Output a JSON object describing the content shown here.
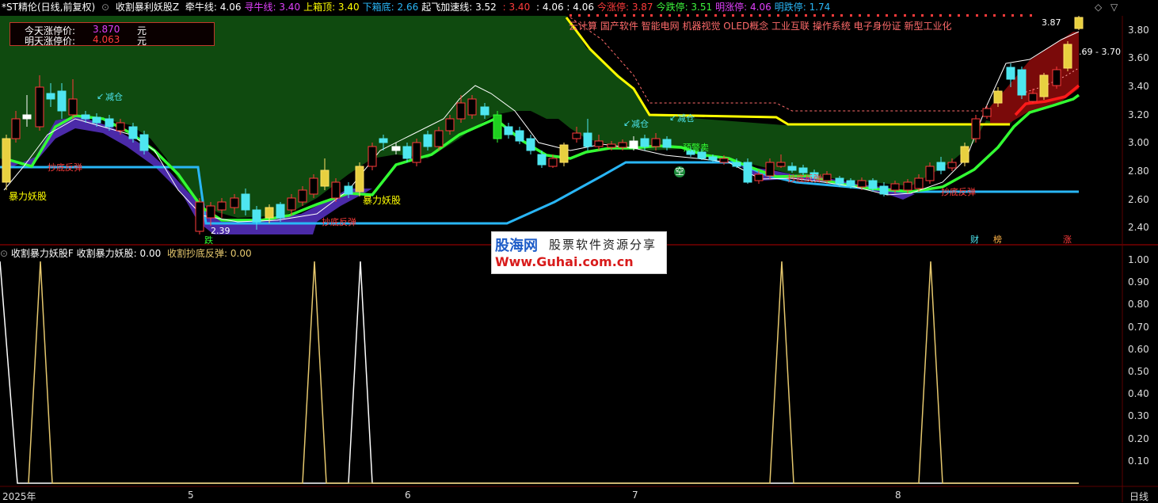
{
  "header": {
    "stock_name": "*ST精伦(日线,前复权)",
    "indicator_name": "收割暴利妖股Z",
    "items": [
      {
        "label": "牵牛线:",
        "value": "4.06",
        "color": "#ffffff"
      },
      {
        "label": "寻牛线:",
        "value": "3.40",
        "color": "#e040fb"
      },
      {
        "label": "上箱顶:",
        "value": "3.40",
        "color": "#ffff00"
      },
      {
        "label": "下箱底:",
        "value": "2.66",
        "color": "#29b6f6"
      },
      {
        "label": "起飞加速线:",
        "value": "3.52",
        "color": "#ffffff"
      },
      {
        "label": "",
        "value": ": 3.40",
        "color": "#ff3b3b"
      },
      {
        "label": "",
        "value": ": 4.06 : 4.06",
        "color": "#ffffff"
      },
      {
        "label": "今涨停:",
        "value": "3.87",
        "color": "#ff3b3b"
      },
      {
        "label": "今跌停:",
        "value": "3.51",
        "color": "#3df53d"
      },
      {
        "label": "明涨停:",
        "value": "4.06",
        "color": "#e040fb"
      },
      {
        "label": "明跌停:",
        "value": "1.74",
        "color": "#29b6f6"
      }
    ]
  },
  "info_box": {
    "today_label": "今天涨停价:",
    "today_value": "3.870",
    "tomorrow_label": "明天涨停价:",
    "tomorrow_value": "4.063",
    "unit": "元"
  },
  "concepts_text": "云计算 国产软件 智能电网 机器视觉 OLED概念 工业互联 操作系统 电子身份证 新型工业化",
  "price_axis": {
    "ticks": [
      "3.80",
      "3.60",
      "3.40",
      "3.20",
      "3.00",
      "2.80",
      "2.60",
      "2.40"
    ],
    "range": [
      2.3,
      3.9
    ]
  },
  "price_label_top": "3.87",
  "price_label_range": ".69 - 3.70",
  "low_label": "2.39",
  "annotations": {
    "reduce1": "减仓",
    "reduce2": "减仓",
    "reduce3": "减仓",
    "warning_sell": "预警卖",
    "empty": "空",
    "rebound1": "抄底反弹",
    "rebound2": "抄底反弹",
    "rebound3": "抄底反弹",
    "rebound4": "抄底反弹",
    "surge1": "暴力妖股",
    "surge2": "暴力妖股",
    "drop": "跌",
    "finance": "财",
    "rank": "榜",
    "up": "涨"
  },
  "sub_indicator": {
    "name": "收割暴力妖股F",
    "line1_label": "收割暴力妖股:",
    "line1_value": "0.00",
    "line2_label": "收割抄底反弹:",
    "line2_value": "0.00",
    "axis_ticks": [
      "1.00",
      "0.90",
      "0.80",
      "0.70",
      "0.60",
      "0.50",
      "0.40",
      "0.30",
      "0.20",
      "0.10"
    ],
    "axis_range": [
      0,
      1.0
    ]
  },
  "x_axis": {
    "labels": [
      "2025年",
      "5",
      "6",
      "7",
      "8"
    ],
    "period": "日线"
  },
  "watermark": {
    "brand": "股海网",
    "slogan": "股票软件资源分享",
    "url": "Www.Guhai.com.cn"
  },
  "colors": {
    "up": "#ff3b3b",
    "down": "#4ee6f0",
    "green_line": "#33ff33",
    "yellow_line": "#ffff00",
    "blue_line": "#29b6f6",
    "fill_green": "#0f4a0f",
    "fill_purple": "#4b2aa8",
    "fill_red": "#7a0a0a"
  }
}
